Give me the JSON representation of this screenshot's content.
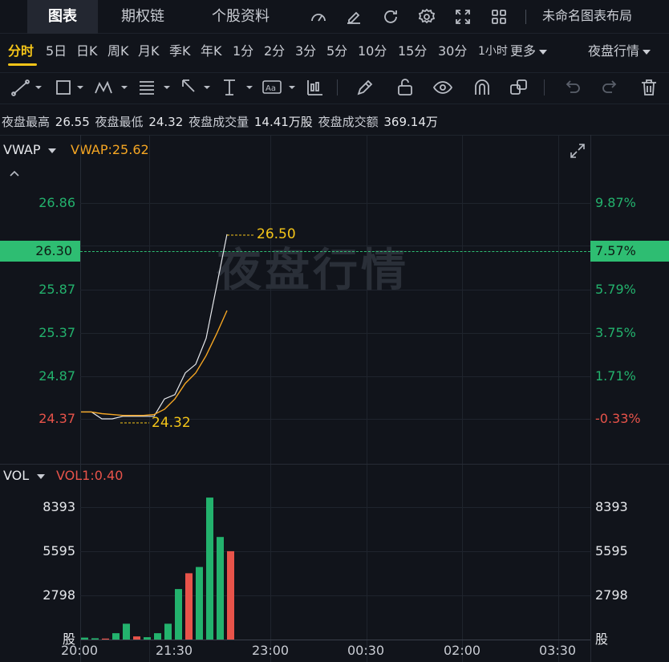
{
  "nav": {
    "tabs": [
      "图表",
      "期权链",
      "个股资料"
    ],
    "active_tab": "图表",
    "layout_name": "未命名图表布局",
    "icons": [
      "speedometer-icon",
      "edit-note-icon",
      "refresh-icon",
      "settings-icon",
      "fullscreen-icon",
      "layout-grid-icon"
    ]
  },
  "periods": {
    "items": [
      "分时",
      "5日",
      "日K",
      "周K",
      "月K",
      "季K",
      "年K",
      "1分",
      "2分",
      "3分",
      "5分",
      "10分",
      "15分",
      "30分",
      "1小时",
      "更多"
    ],
    "active": "分时",
    "session_select": "夜盘行情"
  },
  "toolbar": {
    "tools": [
      "line-tool-icon",
      "rectangle-tool-icon",
      "pattern-tool-icon",
      "fib-tool-icon",
      "arrow-tool-icon",
      "measure-tool-icon",
      "text-tool-icon",
      "candle-tool-icon",
      "pen-icon",
      "unlock-icon",
      "eye-icon",
      "magnet-icon",
      "layers-icon",
      "undo-icon",
      "redo-icon",
      "trash-icon"
    ]
  },
  "stats": {
    "high_label": "夜盘最高",
    "high": "26.55",
    "low_label": "夜盘最低",
    "low": "24.32",
    "volume_label": "夜盘成交量",
    "volume": "14.41万股",
    "amount_label": "夜盘成交额",
    "amount": "369.14万"
  },
  "main_panel": {
    "indicator": "VWAP",
    "indicator_value": "VWAP:25.62",
    "price_ticks": [
      "26.86",
      "25.87",
      "25.37",
      "24.87",
      "24.37"
    ],
    "pct_ticks": [
      "9.87%",
      "5.79%",
      "3.75%",
      "1.71%",
      "-0.33%"
    ],
    "current_price": "26.30",
    "current_pct": "7.57%",
    "high_marker": "26.50",
    "low_marker": "24.32",
    "watermark": "夜盘行情",
    "colors": {
      "up": "#23b26d",
      "down": "#e8534a",
      "price_line": "#e6e8ec",
      "vwap_line": "#f5a623",
      "marker": "#f5c518"
    }
  },
  "volume_panel": {
    "indicator": "VOL",
    "indicator_value": "VOL1:0.40",
    "ticks": [
      "8393",
      "5595",
      "2798"
    ],
    "unit": "股"
  },
  "time_axis": [
    "20:00",
    "21:30",
    "23:00",
    "00:30",
    "02:00",
    "03:30"
  ],
  "chart_data": [
    {
      "type": "line",
      "title": "",
      "x": [
        "20:00",
        "20:10",
        "20:20",
        "20:30",
        "20:40",
        "20:50",
        "21:00",
        "21:10",
        "21:20",
        "21:30",
        "21:40",
        "21:50",
        "22:00",
        "22:10",
        "22:20"
      ],
      "series": [
        {
          "name": "",
          "values": [
            24.45,
            24.45,
            24.37,
            24.37,
            24.4,
            24.4,
            24.4,
            24.4,
            24.6,
            24.65,
            24.9,
            25.0,
            25.3,
            25.9,
            26.5
          ]
        },
        {
          "name": "VWAP",
          "values": [
            24.45,
            24.45,
            24.43,
            24.42,
            24.41,
            24.41,
            24.41,
            24.42,
            24.48,
            24.6,
            24.78,
            24.9,
            25.1,
            25.35,
            25.62
          ]
        }
      ],
      "ylim": [
        24.2,
        27.05
      ],
      "high": 26.5,
      "low": 24.32
    },
    {
      "type": "bar",
      "title": "",
      "ylim": [
        0,
        9500
      ],
      "categories": [
        "20:00",
        "20:10",
        "20:20",
        "20:30",
        "20:40",
        "20:50",
        "21:00",
        "21:10",
        "21:20",
        "21:30",
        "21:40",
        "21:50",
        "22:00",
        "22:10",
        "22:20"
      ],
      "values": [
        120,
        80,
        60,
        400,
        1000,
        200,
        150,
        400,
        1000,
        3200,
        4200,
        4600,
        9000,
        6500,
        5600
      ],
      "directions": [
        "up",
        "up",
        "down",
        "up",
        "up",
        "down",
        "up",
        "up",
        "up",
        "up",
        "down",
        "up",
        "up",
        "up",
        "down"
      ]
    }
  ]
}
